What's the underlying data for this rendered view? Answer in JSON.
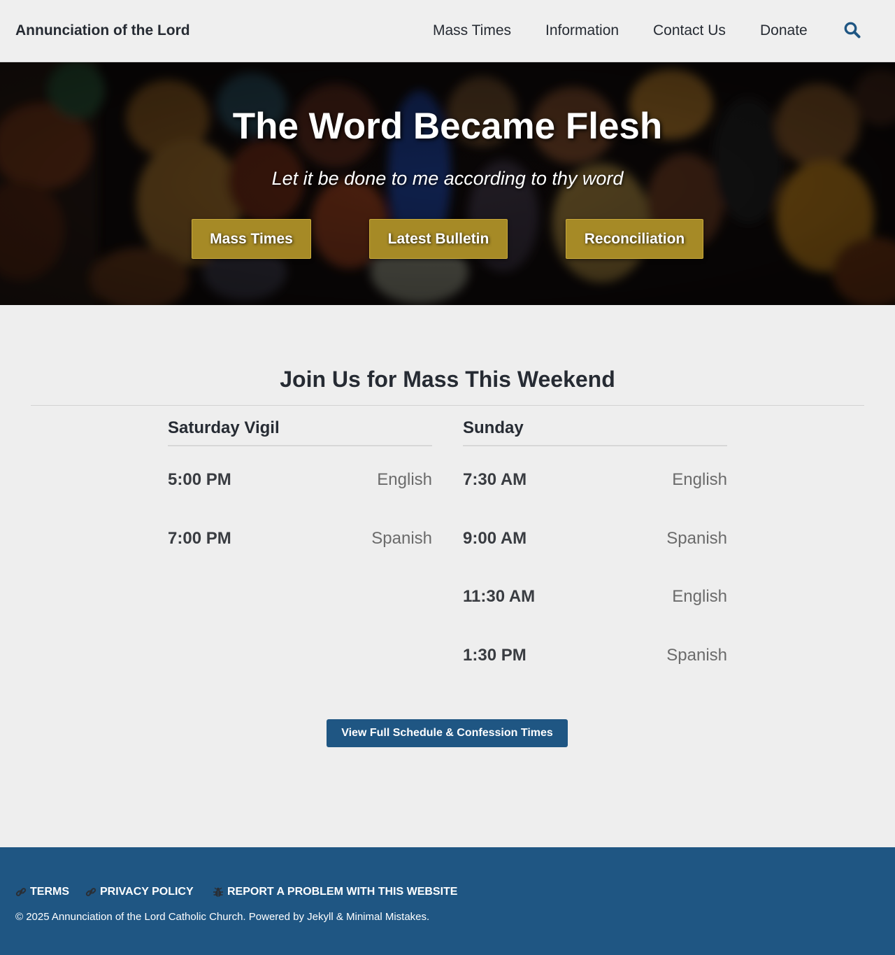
{
  "header": {
    "site_title": "Annunciation of the Lord",
    "nav": [
      "Mass Times",
      "Information",
      "Contact Us",
      "Donate"
    ],
    "search_icon": "search-icon",
    "accent_color": "#1f5683"
  },
  "hero": {
    "title": "The Word Became Flesh",
    "subtitle": "Let it be done to me according to thy word",
    "buttons": [
      "Mass Times",
      "Latest Bulletin",
      "Reconciliation"
    ],
    "button_color": "#a68a26"
  },
  "mass": {
    "title": "Join Us for Mass This Weekend",
    "saturday": {
      "heading": "Saturday Vigil",
      "rows": [
        {
          "time": "5:00 PM",
          "lang": "English"
        },
        {
          "time": "7:00 PM",
          "lang": "Spanish"
        }
      ]
    },
    "sunday": {
      "heading": "Sunday",
      "rows": [
        {
          "time": "7:30 AM",
          "lang": "English"
        },
        {
          "time": "9:00 AM",
          "lang": "Spanish"
        },
        {
          "time": "11:30 AM",
          "lang": "English"
        },
        {
          "time": "1:30 PM",
          "lang": "Spanish"
        }
      ]
    },
    "schedule_button": "View Full Schedule & Confession Times"
  },
  "footer": {
    "links": [
      {
        "label": "Terms",
        "icon": "link-icon"
      },
      {
        "label": "Privacy Policy",
        "icon": "link-icon"
      },
      {
        "label": "Report a problem with this website",
        "icon": "bug-icon"
      }
    ],
    "copyright": "© 2025 Annunciation of the Lord Catholic Church. Powered by Jekyll & Minimal Mistakes.",
    "background": "#1f5683"
  }
}
